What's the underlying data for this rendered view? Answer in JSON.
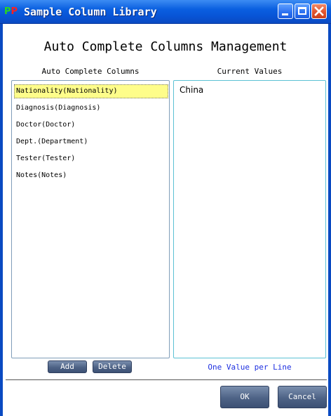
{
  "window": {
    "title": "Sample Column Library",
    "app_icon_letters": [
      "P",
      "P"
    ]
  },
  "main": {
    "title": "Auto Complete Columns Management"
  },
  "left_panel": {
    "header": "Auto Complete Columns",
    "items": [
      "Nationality(Nationality)",
      "Diagnosis(Diagnosis)",
      "Doctor(Doctor)",
      "Dept.(Department)",
      "Tester(Tester)",
      "Notes(Notes)"
    ],
    "selected_index": 0
  },
  "right_panel": {
    "header": "Current Values",
    "value": "China",
    "hint": "One Value per Line"
  },
  "buttons": {
    "add": "Add",
    "delete": "Delete",
    "ok": "OK",
    "cancel": "Cancel"
  },
  "colors": {
    "titlebar": "#0a5fe0",
    "selected_item": "#fefd8a",
    "hint_text": "#1d2fe0",
    "button": "#4e6386"
  }
}
